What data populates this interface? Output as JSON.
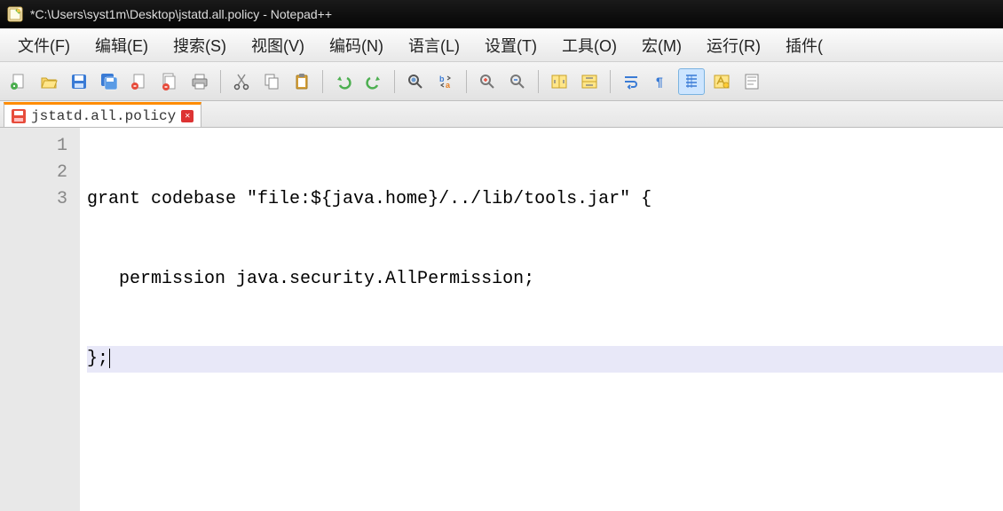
{
  "window": {
    "title": "*C:\\Users\\syst1m\\Desktop\\jstatd.all.policy - Notepad++"
  },
  "menu": {
    "items": [
      "文件(F)",
      "编辑(E)",
      "搜索(S)",
      "视图(V)",
      "编码(N)",
      "语言(L)",
      "设置(T)",
      "工具(O)",
      "宏(M)",
      "运行(R)",
      "插件("
    ]
  },
  "tab": {
    "label": "jstatd.all.policy"
  },
  "editor": {
    "lines": [
      "grant codebase \"file:${java.home}/../lib/tools.jar\" {",
      "   permission java.security.AllPermission;",
      "};"
    ],
    "gutter": [
      "1",
      "2",
      "3"
    ],
    "current_line_index": 2
  }
}
